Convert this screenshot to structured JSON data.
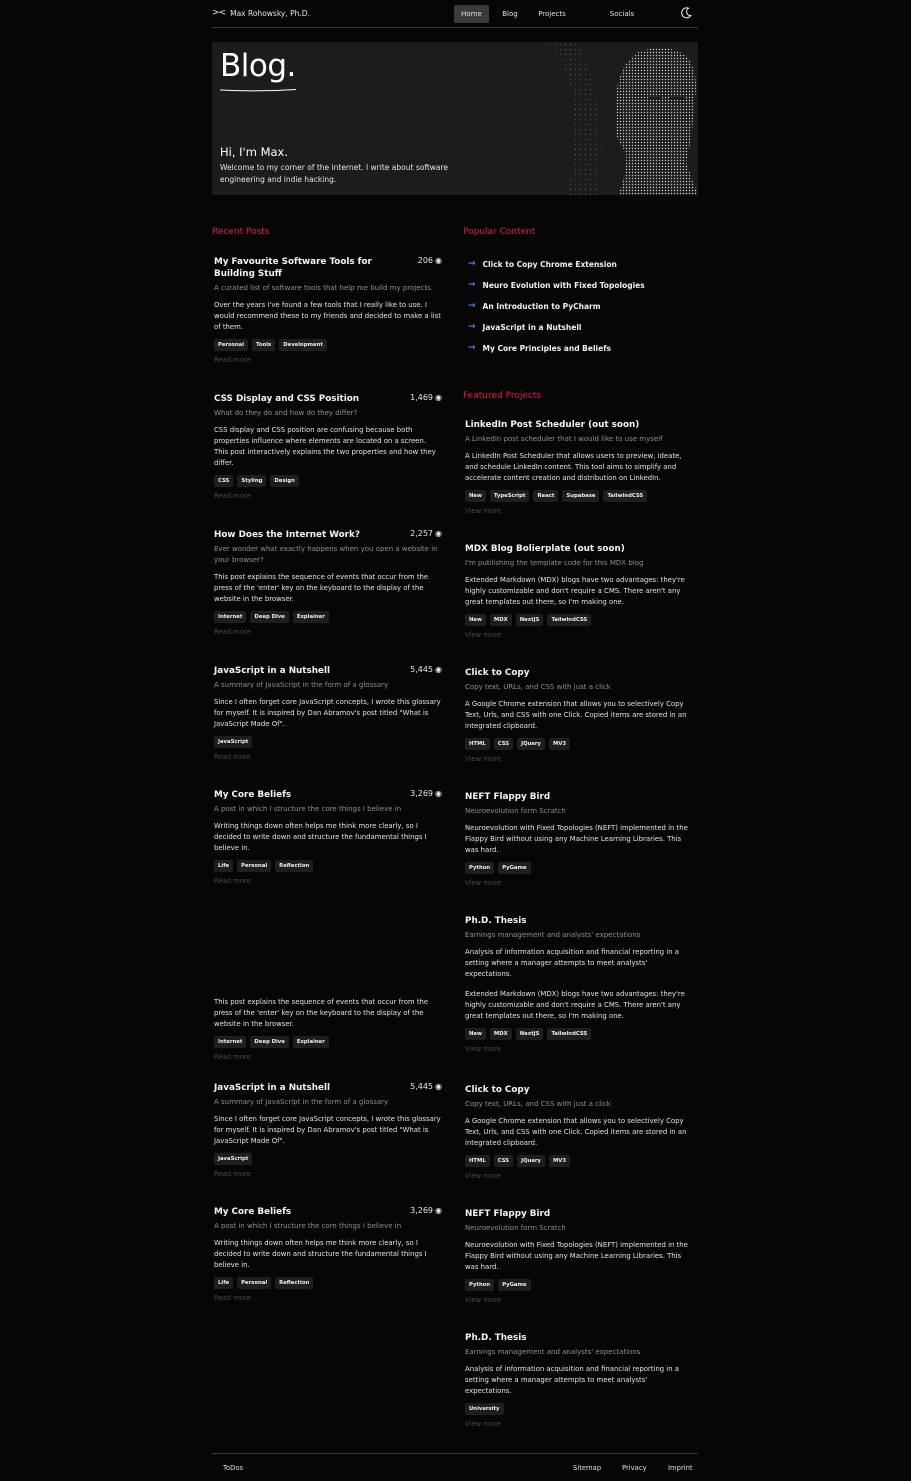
{
  "nav": {
    "brand": "Max Rohowsky, Ph.D.",
    "links": [
      "Home",
      "Blog",
      "Projects",
      "Socials"
    ]
  },
  "hero": {
    "title": "Blog.",
    "greeting": "Hi, I'm Max.",
    "intro": "Welcome to my corner of the internet. I write about software engineering and indie hacking."
  },
  "recent": {
    "heading": "Recent Posts",
    "read_more": "Read more",
    "posts": [
      {
        "title": "My Favourite Software Tools for Building Stuff",
        "views": "206",
        "subtitle": "A curated list of software tools that help me build my projects.",
        "body": "Over the years I've found a few tools that I really like to use. I would recommend these to my friends and decided to make a list of them.",
        "tags": [
          "Personal",
          "Tools",
          "Development"
        ]
      },
      {
        "title": "CSS Display and CSS Position",
        "views": "1,469",
        "subtitle": "What do they do and how do they differ?",
        "body": "CSS display and CSS position are confusing because both properties influence where elements are located on a screen. This post interactively explains the two properties and how they differ.",
        "tags": [
          "CSS",
          "Styling",
          "Design"
        ]
      },
      {
        "title": "How Does the Internet Work?",
        "views": "2,257",
        "subtitle": "Ever wonder what exactly happens when you open a website in your browser?",
        "body": "This post explains the sequence of events that occur from the press of the 'enter' key on the keyboard to the display of the website in the browser.",
        "tags": [
          "Internet",
          "Deep Dive",
          "Explainer"
        ]
      },
      {
        "title": "JavaScript in a Nutshell",
        "views": "5,445",
        "subtitle": "A summary of JavaScript in the form of a glossary",
        "body": "Since I often forget core JavaScript concepts, I wrote this glossary for myself. It is inspired by Dan Abramov's post titled \"What is JavaScript Made Of\".",
        "tags": [
          "JavaScript"
        ]
      },
      {
        "title": "My Core Beliefs",
        "views": "3,269",
        "subtitle": "A post in which I structure the core things I believe in",
        "body": "Writing things down often helps me think more clearly, so I decided to write down and structure the fundamental things I believe in.",
        "tags": [
          "Life",
          "Personal",
          "Reflection"
        ]
      },
      {
        "title": "",
        "views": "",
        "subtitle": "",
        "body": "This post explains the sequence of events that occur from the press of the 'enter' key on the keyboard to the display of the website in the browser.",
        "tags": [
          "Internet",
          "Deep Dive",
          "Explainer"
        ]
      },
      {
        "title": "JavaScript in a Nutshell",
        "views": "5,445",
        "subtitle": "A summary of JavaScript in the form of a glossary",
        "body": "Since I often forget core JavaScript concepts, I wrote this glossary for myself. It is inspired by Dan Abramov's post titled \"What is JavaScript Made Of\".",
        "tags": [
          "JavaScript"
        ]
      },
      {
        "title": "My Core Beliefs",
        "views": "3,269",
        "subtitle": "A post in which I structure the core things I believe in",
        "body": "Writing things down often helps me think more clearly, so I decided to write down and structure the fundamental things I believe in.",
        "tags": [
          "Life",
          "Personal",
          "Reflection"
        ]
      }
    ]
  },
  "popular": {
    "heading": "Popular Content",
    "items": [
      "Click to Copy Chrome Extension",
      "Neuro Evolution with Fixed Topologies",
      "An Introduction to PyCharm",
      "JavaScript in a Nutshell",
      "My Core Principles and Beliefs"
    ]
  },
  "featured": {
    "heading": "Featured Projects",
    "view_more": "View more",
    "projects": [
      {
        "title": "LinkedIn Post Scheduler (out soon)",
        "subtitle": "A LinkedIn post scheduler that I would like to use myself",
        "body": "A LinkedIn Post Scheduler that allows users to preview, ideate, and schedule LinkedIn content. This tool aims to simplify and accelerate content creation and distribution on LinkedIn.",
        "body2": "",
        "tags": [
          "New",
          "TypeScript",
          "React",
          "Supabase",
          "TailwindCSS"
        ]
      },
      {
        "title": "MDX Blog Bolierplate (out soon)",
        "subtitle": "I'm publishing the template code for this MDX blog",
        "body": "Extended Markdown (MDX) blogs have two advantages: they're highly customizable and don't require a CMS. There aren't any great templates out there, so I'm making one.",
        "body2": "",
        "tags": [
          "New",
          "MDX",
          "NextJS",
          "TailwindCSS"
        ]
      },
      {
        "title": "Click to Copy",
        "subtitle": "Copy text, URLs, and CSS with just a click",
        "body": "A Google Chrome extension that allows you to selectively Copy Text, Urls, and CSS with one Click. Copied items are stored in an integrated clipboard.",
        "body2": "",
        "tags": [
          "HTML",
          "CSS",
          "JQuery",
          "MV3"
        ]
      },
      {
        "title": "NEFT Flappy Bird",
        "subtitle": "Neuroevolution form Scratch",
        "body": "Neuroevolution with Fixed Topologies (NEFT) implemented in the Flappy Bird without using any Machine Learning Libraries. This was hard.",
        "body2": "",
        "tags": [
          "Python",
          "PyGame"
        ]
      },
      {
        "title": "Ph.D. Thesis",
        "subtitle": "Earnings management and analysts' expectations",
        "body": "Analysis of information acquisition and financial reporting in a setting where a manager attempts to meet analysts' expectations.",
        "body2": "Extended Markdown (MDX) blogs have two advantages: they're highly customizable and don't require a CMS. There aren't any great templates out there, so I'm making one.",
        "tags": [
          "New",
          "MDX",
          "NextJS",
          "TailwindCSS"
        ]
      },
      {
        "title": "Click to Copy",
        "subtitle": "Copy text, URLs, and CSS with just a click",
        "body": "A Google Chrome extension that allows you to selectively Copy Text, Urls, and CSS with one Click. Copied items are stored in an integrated clipboard.",
        "body2": "",
        "tags": [
          "HTML",
          "CSS",
          "JQuery",
          "MV3"
        ]
      },
      {
        "title": "NEFT Flappy Bird",
        "subtitle": "Neuroevolution form Scratch",
        "body": "Neuroevolution with Fixed Topologies (NEFT) implemented in the Flappy Bird without using any Machine Learning Libraries. This was hard.",
        "body2": "",
        "tags": [
          "Python",
          "PyGame"
        ]
      },
      {
        "title": "Ph.D. Thesis",
        "subtitle": "Earnings management and analysts' expectations",
        "body": "Analysis of information acquisition and financial reporting in a setting where a manager attempts to meet analysts' expectations.",
        "body2": "",
        "tags": [
          "University"
        ]
      }
    ]
  },
  "footer": {
    "left": "ToDos",
    "links": [
      "Sitemap",
      "Privacy",
      "Imprint"
    ]
  },
  "colors": {
    "accent": "#e3184f",
    "arrow": "#4a7ee8",
    "background": "#060606"
  },
  "icons": {
    "brand": "double-chevron-icon",
    "theme": "moon-icon",
    "views": "eye-icon",
    "popular": "arrow-right-icon"
  }
}
